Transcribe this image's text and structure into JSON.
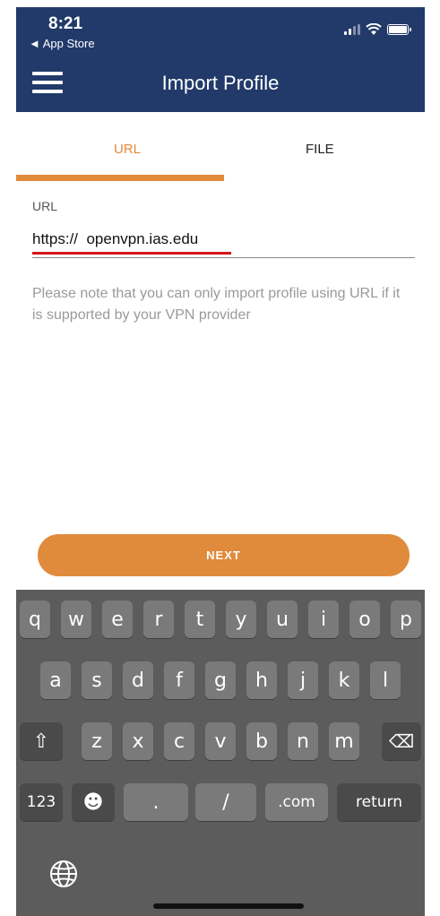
{
  "status": {
    "time": "8:21",
    "back_label": "◄ App Store"
  },
  "header": {
    "title": "Import Profile"
  },
  "tabs": [
    {
      "label": "URL"
    },
    {
      "label": "FILE"
    }
  ],
  "url_field": {
    "label": "URL",
    "value": "https://  openvpn.ias.edu"
  },
  "note": "Please note that you can only import profile using URL if it is supported by your VPN provider",
  "next_label": "NEXT",
  "keyboard": {
    "row1": [
      "q",
      "w",
      "e",
      "r",
      "t",
      "y",
      "u",
      "i",
      "o",
      "p"
    ],
    "row2": [
      "a",
      "s",
      "d",
      "f",
      "g",
      "h",
      "j",
      "k",
      "l"
    ],
    "row3": [
      "z",
      "x",
      "c",
      "v",
      "b",
      "n",
      "m"
    ],
    "shift_icon": "⇧",
    "delete_icon": "⌫",
    "numbers_label": "123",
    "emoji_icon": "☻",
    "period_label": ".",
    "slash_label": "/",
    "com_label": ".com",
    "return_label": "return",
    "globe_icon": "globe-icon"
  },
  "colors": {
    "header": "#213a6a",
    "accent": "#e08a3b",
    "highlight": "#d6141b"
  }
}
